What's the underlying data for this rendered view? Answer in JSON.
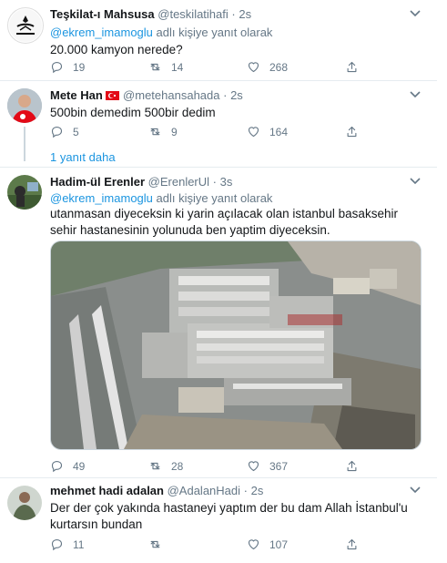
{
  "tweets": [
    {
      "name": "Teşkilat-ı Mahsusa",
      "handle": "@teskilatihafi",
      "time": "2s",
      "reply_prefix": "@ekrem_imamoglu",
      "reply_suffix": "adlı kişiye yanıt olarak",
      "text": "20.000 kamyon nerede?",
      "replies": "19",
      "retweets": "14",
      "likes": "268"
    },
    {
      "name": "Mete Han",
      "handle": "@metehansahada",
      "time": "2s",
      "text": "500bin demedim 500bir dedim",
      "replies": "5",
      "retweets": "9",
      "likes": "164",
      "more_replies": "1 yanıt daha"
    },
    {
      "name": "Hadim-ül Erenler",
      "handle": "@ErenlerUl",
      "time": "3s",
      "reply_prefix": "@ekrem_imamoglu",
      "reply_suffix": "adlı kişiye yanıt olarak",
      "text": "utanmasan diyeceksin ki yarin açılacak olan istanbul basaksehir sehir hastanesinin yolunuda ben yaptim diyeceksin.",
      "replies": "49",
      "retweets": "28",
      "likes": "367"
    },
    {
      "name": "mehmet hadi adalan",
      "handle": "@AdalanHadi",
      "time": "2s",
      "text": "Der der çok yakında hastaneyi yaptım der bu dam Allah İstanbul'u kurtarsın bundan",
      "replies": "11",
      "retweets": "",
      "likes": "107"
    }
  ],
  "colors": {
    "name": "#14171a",
    "meta": "#657786",
    "link": "#1b95e0",
    "divider": "#e6ecf0"
  },
  "icons": [
    "reply-icon",
    "retweet-icon",
    "like-icon",
    "share-icon",
    "caret-down-icon"
  ]
}
